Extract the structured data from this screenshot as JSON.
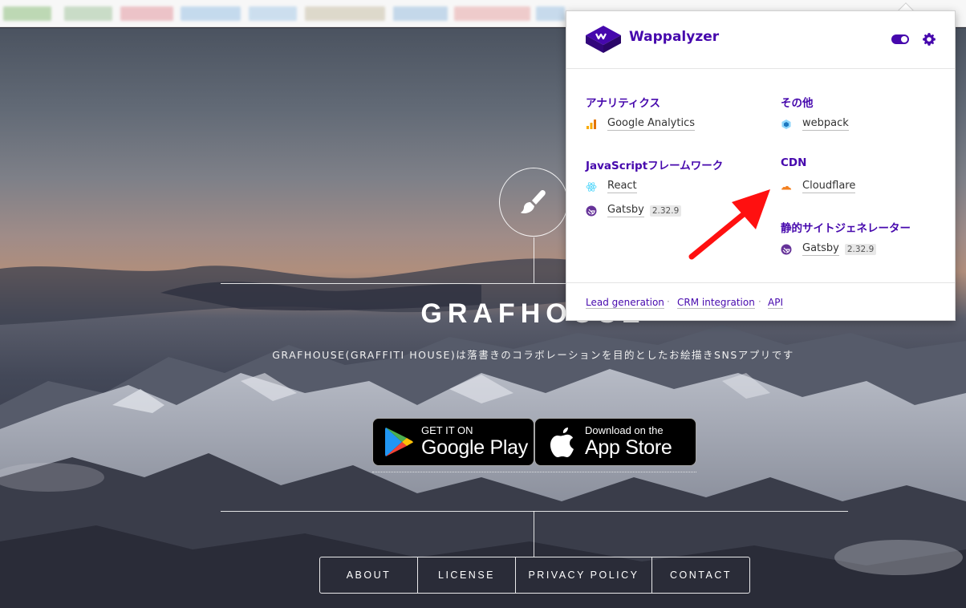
{
  "popup": {
    "brand": "Wappalyzer",
    "categories": [
      {
        "name": "アナリティクス",
        "techs": [
          {
            "name": "Google Analytics",
            "version": ""
          }
        ]
      },
      {
        "name": "その他",
        "techs": [
          {
            "name": "webpack",
            "version": ""
          }
        ]
      },
      {
        "name": "JavaScriptフレームワーク",
        "techs": [
          {
            "name": "React",
            "version": ""
          },
          {
            "name": "Gatsby",
            "version": "2.32.9"
          }
        ]
      },
      {
        "name": "CDN",
        "techs": [
          {
            "name": "Cloudflare",
            "version": ""
          }
        ]
      },
      {
        "name": "静的サイトジェネレーター",
        "techs": [
          {
            "name": "Gatsby",
            "version": "2.32.9"
          }
        ]
      }
    ],
    "footer_links": [
      "Lead generation",
      "CRM integration",
      "API"
    ],
    "accent": "#4608ad"
  },
  "hero": {
    "title": "GRAFHOUSE",
    "subtitle": "GRAFHOUSE(GRAFFITI HOUSE)は落書きのコラボレーションを目的としたお絵描きSNSアプリです",
    "google_play": {
      "small": "GET IT ON",
      "big": "Google Play"
    },
    "app_store": {
      "small": "Download on the",
      "big": "App Store"
    },
    "nav": [
      "ABOUT",
      "LICENSE",
      "PRIVACY POLICY",
      "CONTACT"
    ]
  },
  "icons": [
    "paintbrush-icon",
    "google-play-logo-icon",
    "apple-logo-icon",
    "wappalyzer-logo-icon",
    "gear-icon",
    "google-analytics-icon",
    "webpack-icon",
    "react-icon",
    "gatsby-icon",
    "cloudflare-icon"
  ]
}
